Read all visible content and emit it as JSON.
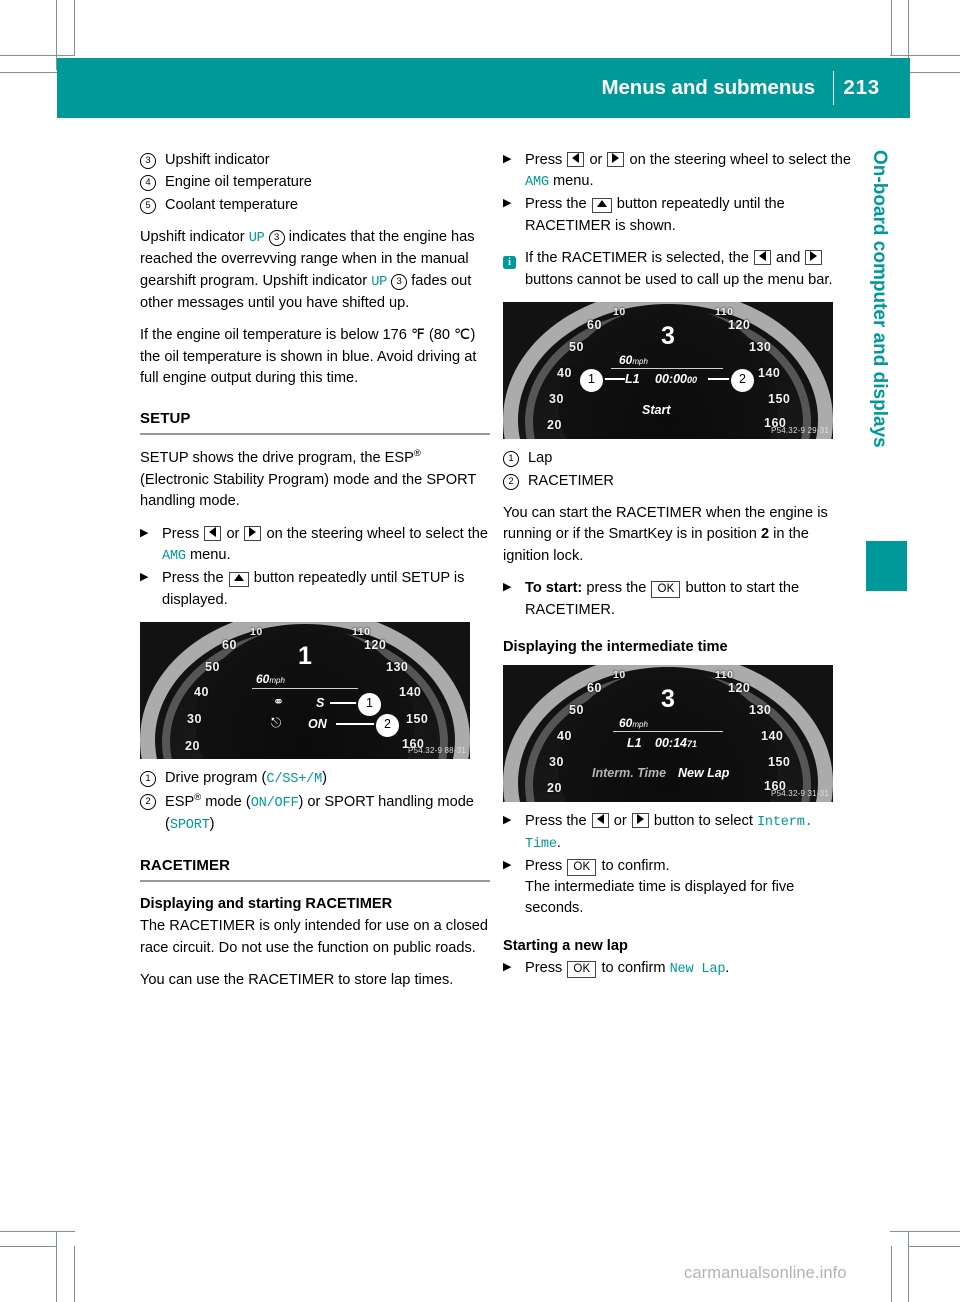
{
  "header": {
    "title": "Menus and submenus",
    "page_number": "213"
  },
  "chapter_tab": {
    "label": "On-board computer and displays",
    "accent_color": "#009999"
  },
  "watermark": "carmanualsonline.info",
  "left_column": {
    "legend_top": [
      {
        "num": "3",
        "text": "Upshift indicator"
      },
      {
        "num": "4",
        "text": "Engine oil temperature"
      },
      {
        "num": "5",
        "text": "Coolant temperature"
      }
    ],
    "para_upshift_1": "Upshift indicator",
    "para_upshift_1_code": "UP",
    "para_upshift_1_num": "3",
    "para_upshift_1_rest": "indicates that the engine has reached the overrevving range when in the manual gearshift program.",
    "para_upshift_2": "Upshift indicator",
    "para_upshift_2_code": "UP",
    "para_upshift_2_num": "3",
    "para_upshift_2_rest": "fades out other messages until you have shifted up.",
    "para_oil_temp": "If the engine oil temperature is below 176 ℉ (80 ℃) the oil temperature is shown in blue. Avoid driving at full engine output during this time.",
    "setup_heading": "SETUP",
    "setup_intro_a": "SETUP shows the drive program, the ESP",
    "setup_intro_b": "(Electronic Stability Program) mode and the SPORT handling mode.",
    "step_press_label": "Press",
    "step_or_label": "or",
    "step_steering_rest": "on the steering wheel to select the",
    "step_amg_code": "AMG",
    "step_menu_word": "menu.",
    "step_press_the": "Press the",
    "step_until_setup": "button repeatedly until SETUP is displayed.",
    "figure_setup": {
      "gear": "1",
      "speed": "60",
      "speed_unit": "mph",
      "scale": [
        "20",
        "30",
        "40",
        "50",
        "60",
        "10",
        "110",
        "120",
        "130",
        "140",
        "150",
        "160"
      ],
      "item_1": "S",
      "item_2": "ON",
      "callout_1": "1",
      "callout_2": "2",
      "code": "P54.32-9 88-31"
    },
    "legend_setup": [
      {
        "num": "1",
        "label": "Drive program (",
        "code": "C/SS+/M",
        "tail": ")"
      },
      {
        "num": "2",
        "label": "ESP",
        "code": "ON/OFF",
        "tail": ") or SPORT handling mode (",
        "code2": "SPORT",
        "tail2": ")",
        "mid": " mode ("
      }
    ],
    "racetimer_heading": "RACETIMER",
    "racetimer_sub": "Displaying and starting RACETIMER",
    "racetimer_para_1": "The RACETIMER is only intended for use on a closed race circuit. Do not use the function on public roads.",
    "racetimer_para_2": "You can use the RACETIMER to store lap times."
  },
  "right_column": {
    "step_press_label": "Press",
    "step_or_label": "or",
    "step_steering_rest": "on the steering wheel to select the",
    "step_amg_code": "AMG",
    "step_menu_word": "menu.",
    "step_press_the": "Press the",
    "step_until_racetimer": "button repeatedly until the RACETIMER is shown.",
    "note_text_a": "If the RACETIMER is selected, the",
    "note_text_b": "and",
    "note_text_c": "buttons cannot be used to call up the menu bar.",
    "figure_racetimer": {
      "gear": "3",
      "speed": "60",
      "speed_unit": "mph",
      "lap": "L1",
      "time": "00:00",
      "time_hundredths": "00",
      "start_label": "Start",
      "scale": [
        "20",
        "30",
        "40",
        "50",
        "60",
        "10",
        "110",
        "120",
        "130",
        "140",
        "150",
        "160"
      ],
      "callout_1": "1",
      "callout_2": "2",
      "code": "P54.32-9 29-31"
    },
    "legend_racetimer": [
      {
        "num": "1",
        "text": "Lap"
      },
      {
        "num": "2",
        "text": "RACETIMER"
      }
    ],
    "para_start": "You can start the RACETIMER when the engine is running or if the SmartKey is in position",
    "para_start_bold": "2",
    "para_start_rest": "in the ignition lock.",
    "step_to_start_bold": "To start:",
    "step_to_start_a": "press the",
    "step_to_start_ok": "OK",
    "step_to_start_b": "button to start the RACETIMER.",
    "interm_heading": "Displaying the intermediate time",
    "figure_interm": {
      "gear": "3",
      "speed": "60",
      "speed_unit": "mph",
      "lap": "L1",
      "time": "00:14",
      "time_hundredths": "71",
      "label_interm": "Interm. Time",
      "label_newlap": "New Lap",
      "scale": [
        "20",
        "30",
        "40",
        "50",
        "60",
        "10",
        "110",
        "120",
        "130",
        "140",
        "150",
        "160"
      ],
      "code": "P54.32-9 31-31"
    },
    "step_select_a": "Press the",
    "step_select_or": "or",
    "step_select_b": "button to select",
    "step_select_code": "Interm. Time",
    "step_select_period": ".",
    "step_confirm_a": "Press",
    "step_confirm_ok": "OK",
    "step_confirm_b": "to confirm.",
    "step_confirm_result": "The intermediate time is displayed for five seconds.",
    "newlap_heading": "Starting a new lap",
    "step_newlap_a": "Press",
    "step_newlap_ok": "OK",
    "step_newlap_b": "to confirm",
    "step_newlap_code": "New Lap",
    "step_newlap_period": "."
  }
}
